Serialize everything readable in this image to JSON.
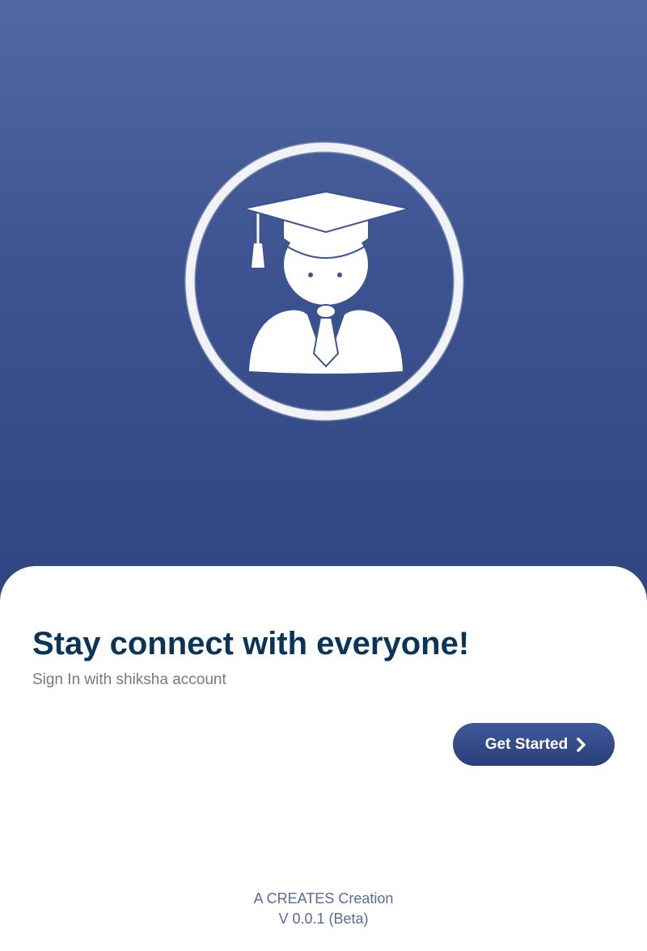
{
  "hero": {
    "logo_icon": "graduate-student-icon",
    "gradient_top": "#4f68a3",
    "gradient_bottom": "#2f4581"
  },
  "content": {
    "headline": "Stay connect with everyone!",
    "subline": "Sign In with shiksha account",
    "cta_label": "Get Started",
    "cta_icon": "chevron-right-icon",
    "accent_color": "#0b3558"
  },
  "footer": {
    "credit": "A CREATES Creation",
    "version": "V 0.0.1 (Beta)"
  }
}
